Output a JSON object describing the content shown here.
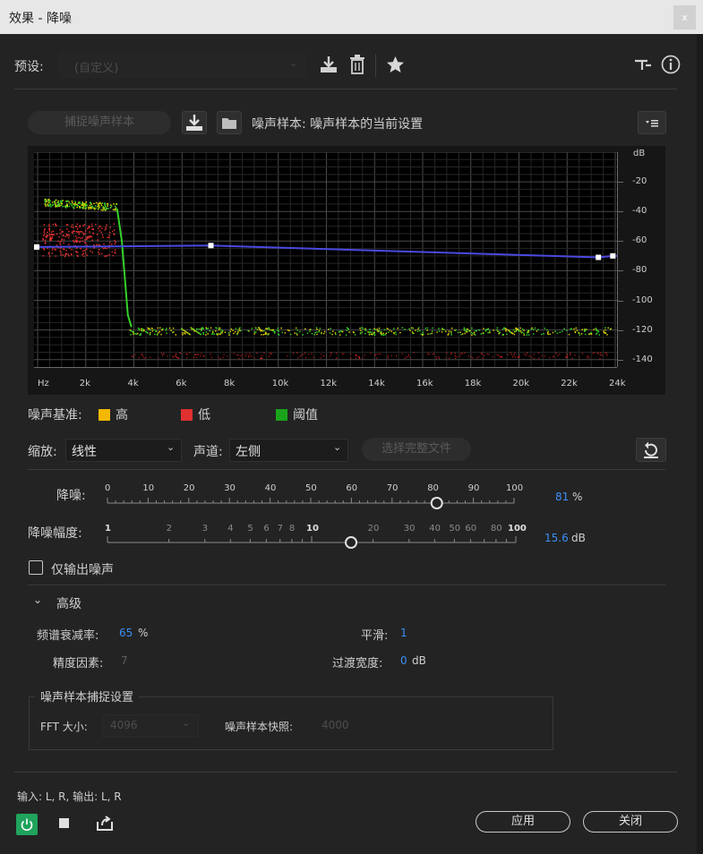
{
  "title": "效果 - 降噪",
  "close_glyph": "x",
  "preset": {
    "label": "预设:",
    "value": "(自定义)"
  },
  "capture_button": "捕捉噪声样本",
  "noise_sample_label": "噪声样本: 噪声样本的当前设置",
  "graph": {
    "db_unit": "dB",
    "y_ticks": [
      "-20",
      "-40",
      "-60",
      "-80",
      "-100",
      "-120",
      "-140"
    ],
    "x_ticks": [
      "Hz",
      "2k",
      "4k",
      "6k",
      "8k",
      "10k",
      "12k",
      "14k",
      "16k",
      "18k",
      "20k",
      "22k",
      "24k"
    ]
  },
  "legend": {
    "title": "噪声基准:",
    "items": [
      {
        "label": "高",
        "color": "#f5b800"
      },
      {
        "label": "低",
        "color": "#e03030"
      },
      {
        "label": "阈值",
        "color": "#1aa31a"
      }
    ]
  },
  "chart_data": {
    "type": "line",
    "xlabel": "",
    "ylabel": "dB",
    "xlim": [
      0,
      24000
    ],
    "ylim": [
      -145,
      0
    ],
    "series": [
      {
        "values_x": [
          0,
          7200,
          23300,
          23900
        ],
        "values_y": [
          -64,
          -63,
          -71,
          -70
        ]
      }
    ]
  },
  "zoom": {
    "label": "缩放:",
    "value": "线性"
  },
  "channel": {
    "label": "声道:",
    "value": "左侧"
  },
  "select_file_button": "选择完整文件",
  "noise_reduction": {
    "label": "降噪:",
    "ticks": [
      "0",
      "10",
      "20",
      "30",
      "40",
      "50",
      "60",
      "70",
      "80",
      "90",
      "100"
    ],
    "value": "81",
    "unit": "%",
    "fraction": 0.81
  },
  "reduce_by": {
    "label": "降噪幅度:",
    "ticks": [
      "1",
      "2",
      "3",
      "4",
      "5",
      "6",
      "7",
      "8",
      "10",
      "20",
      "30",
      "40",
      "50",
      "60",
      "80",
      "100"
    ],
    "value": "15.6",
    "unit": "dB"
  },
  "output_noise_only": "仅输出噪声",
  "advanced": {
    "header": "高级",
    "spectral_decay": {
      "label": "频谱衰减率:",
      "value": "65",
      "unit": "%"
    },
    "smoothing": {
      "label": "平滑:",
      "value": "1"
    },
    "precision": {
      "label": "精度因素:",
      "value": "7"
    },
    "transition": {
      "label": "过渡宽度:",
      "value": "0",
      "unit": "dB"
    },
    "capture_settings": {
      "title": "噪声样本捕捉设置",
      "fft_label": "FFT 大小:",
      "fft_value": "4096",
      "snapshots_label": "噪声样本快照:",
      "snapshots_value": "4000"
    }
  },
  "io_label": "输入: L, R,  输出: L, R",
  "apply_button": "应用",
  "close_button": "关闭",
  "colors": {
    "accent": "#3b8ff5",
    "curve": "#4a4ae0",
    "power": "#1fa35d"
  }
}
